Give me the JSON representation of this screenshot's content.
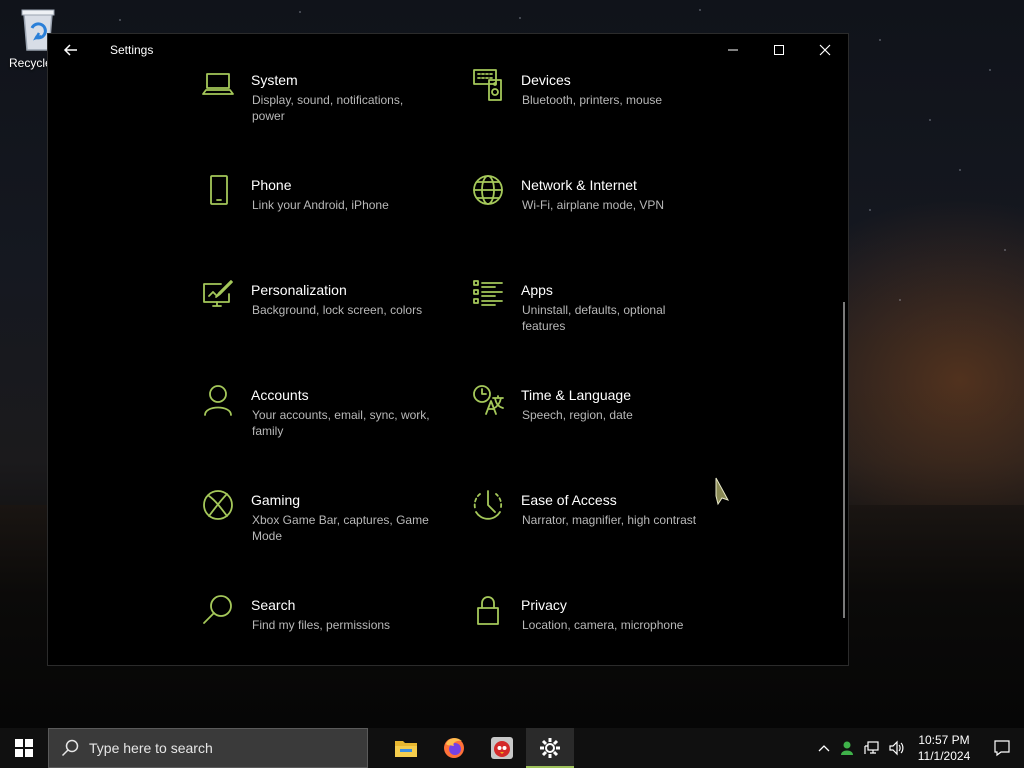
{
  "desktop": {
    "recycle_bin_label": "Recycle"
  },
  "window": {
    "title": "Settings",
    "accent_color": "#a5c85a"
  },
  "categories": [
    {
      "name": "System",
      "desc": "Display, sound, notifications, power",
      "icon": "laptop-icon"
    },
    {
      "name": "Devices",
      "desc": "Bluetooth, printers, mouse",
      "icon": "keyboard-speaker-icon"
    },
    {
      "name": "Phone",
      "desc": "Link your Android, iPhone",
      "icon": "phone-icon"
    },
    {
      "name": "Network & Internet",
      "desc": "Wi-Fi, airplane mode, VPN",
      "icon": "globe-icon"
    },
    {
      "name": "Personalization",
      "desc": "Background, lock screen, colors",
      "icon": "paint-screen-icon"
    },
    {
      "name": "Apps",
      "desc": "Uninstall, defaults, optional features",
      "icon": "apps-list-icon"
    },
    {
      "name": "Accounts",
      "desc": "Your accounts, email, sync, work, family",
      "icon": "person-icon"
    },
    {
      "name": "Time & Language",
      "desc": "Speech, region, date",
      "icon": "time-language-icon"
    },
    {
      "name": "Gaming",
      "desc": "Xbox Game Bar, captures, Game Mode",
      "icon": "xbox-icon"
    },
    {
      "name": "Ease of Access",
      "desc": "Narrator, magnifier, high contrast",
      "icon": "ease-of-access-icon"
    },
    {
      "name": "Search",
      "desc": "Find my files, permissions",
      "icon": "magnifier-icon"
    },
    {
      "name": "Privacy",
      "desc": "Location, camera, microphone",
      "icon": "lock-icon"
    }
  ],
  "taskbar": {
    "search_placeholder": "Type here to search",
    "apps": [
      "file-explorer-icon",
      "firefox-icon",
      "angry-bird-icon",
      "settings-gear-icon"
    ],
    "clock_time": "10:57 PM",
    "clock_date": "11/1/2024"
  }
}
